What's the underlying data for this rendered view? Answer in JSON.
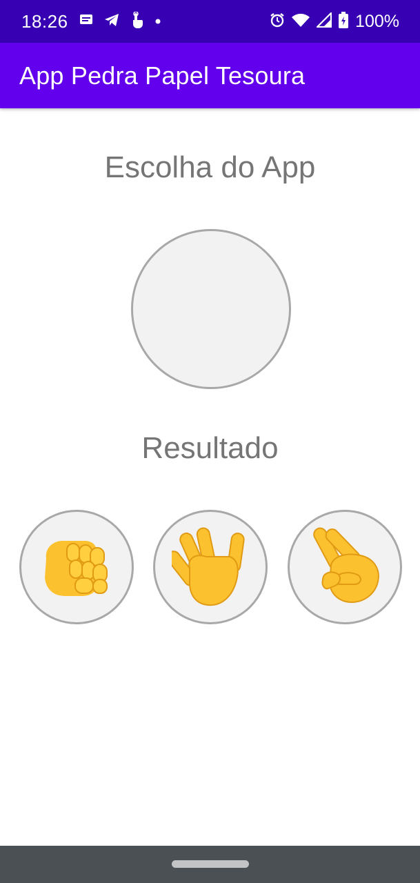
{
  "status_bar": {
    "time": "18:26",
    "battery": "100%",
    "icons": [
      "notification-icon",
      "telegram-icon",
      "touch-icon",
      "dot-icon",
      "alarm-icon",
      "wifi-icon",
      "signal-icon",
      "battery-icon"
    ]
  },
  "app_bar": {
    "title": "App Pedra Papel Tesoura"
  },
  "main": {
    "app_choice_heading": "Escolha do App",
    "result_heading": "Resultado",
    "options": [
      {
        "name": "pedra",
        "icon": "rock-fist-icon"
      },
      {
        "name": "papel",
        "icon": "paper-hand-icon"
      },
      {
        "name": "tesoura",
        "icon": "scissors-hand-icon"
      }
    ]
  },
  "colors": {
    "status_bar": "#3700b3",
    "app_bar": "#6200ee",
    "heading_text": "#757575",
    "circle_border": "#a8a8a8",
    "circle_fill": "#f2f2f2",
    "emoji_yellow": "#fcc12f",
    "nav_bar": "#4b5054"
  }
}
